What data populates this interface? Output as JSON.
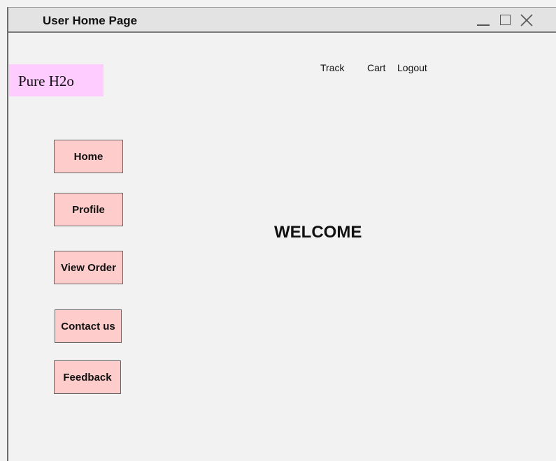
{
  "window": {
    "title": "User Home Page",
    "controls": {
      "minimize_icon": "minimize-icon",
      "maximize_icon": "maximize-icon",
      "close_icon": "close-icon"
    }
  },
  "brand": {
    "logo_text": "Pure H2o",
    "logo_bg": "#ffccff"
  },
  "top_nav": {
    "track": "Track",
    "cart": "Cart",
    "logout": "Logout"
  },
  "sidebar": {
    "button_bg": "#ffcccc",
    "items": [
      {
        "label": "Home"
      },
      {
        "label": "Profile"
      },
      {
        "label": "View Order"
      },
      {
        "label": "Contact us"
      },
      {
        "label": "Feedback"
      }
    ]
  },
  "main": {
    "heading": "WELCOME"
  }
}
